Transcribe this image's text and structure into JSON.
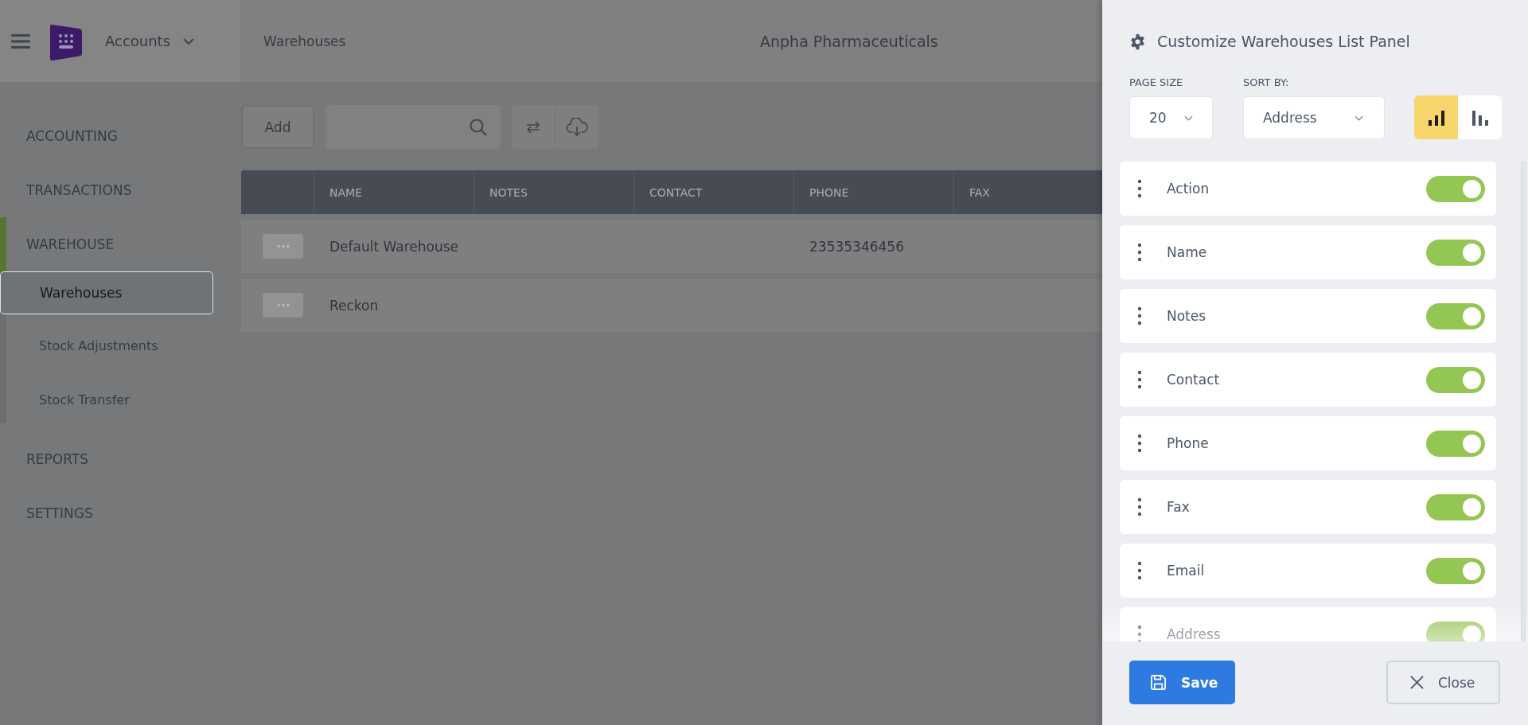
{
  "header": {
    "app_name": "Accounts",
    "breadcrumb": "Warehouses",
    "company": "Anpha Pharmaceuticals"
  },
  "sidebar": {
    "items": [
      {
        "label": "ACCOUNTING",
        "active": false
      },
      {
        "label": "TRANSACTIONS",
        "active": false
      },
      {
        "label": "WAREHOUSE",
        "active": true,
        "children": [
          {
            "label": "Warehouses",
            "selected": true
          },
          {
            "label": "Stock Adjustments",
            "selected": false
          },
          {
            "label": "Stock Transfer",
            "selected": false
          }
        ]
      },
      {
        "label": "REPORTS",
        "active": false
      },
      {
        "label": "SETTINGS",
        "active": false
      }
    ]
  },
  "toolbar": {
    "add_label": "Add"
  },
  "table": {
    "columns": [
      "NAME",
      "NOTES",
      "CONTACT",
      "PHONE",
      "FAX"
    ],
    "rows": [
      {
        "name": "Default Warehouse",
        "phone": "23535346456"
      },
      {
        "name": "Reckon"
      }
    ]
  },
  "panel": {
    "title": "Customize Warehouses List Panel",
    "page_size": {
      "label": "PAGE SIZE",
      "value": "20"
    },
    "sort_by": {
      "label": "SORT BY:",
      "value": "Address"
    },
    "sort_order": [
      {
        "kind": "ascending",
        "selected": true
      },
      {
        "kind": "descending",
        "selected": false
      }
    ],
    "columns": [
      {
        "label": "Action",
        "on": true
      },
      {
        "label": "Name",
        "on": true
      },
      {
        "label": "Notes",
        "on": true
      },
      {
        "label": "Contact",
        "on": true
      },
      {
        "label": "Phone",
        "on": true
      },
      {
        "label": "Fax",
        "on": true
      },
      {
        "label": "Email",
        "on": true
      },
      {
        "label": "Address",
        "on": true
      }
    ],
    "buttons": [
      {
        "kind": "primary",
        "label": "Save"
      },
      {
        "kind": "secondary",
        "label": "Close"
      }
    ]
  }
}
